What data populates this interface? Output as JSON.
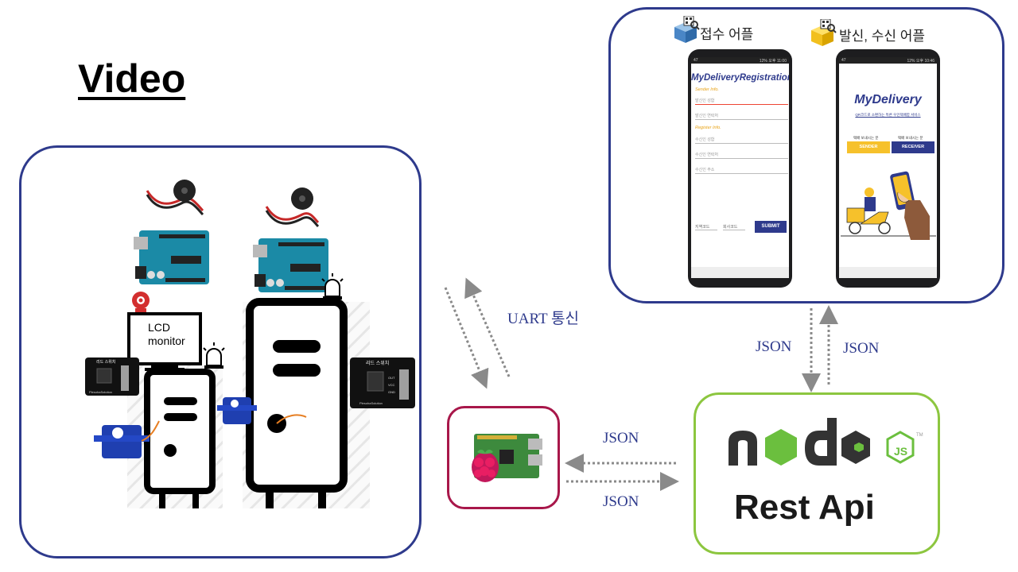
{
  "title": "Video",
  "video": {
    "lcd_label_line1": "LCD",
    "lcd_label_line2": "monitor",
    "reed_switch_label": "리드 스위치",
    "reed_pins": [
      "OUT",
      "VCC",
      "GND"
    ],
    "reed_brand": "PlesohaSolution",
    "arduino_label": "UNO"
  },
  "links": {
    "uart": "UART 통신",
    "json_app_down": "JSON",
    "json_app_up": "JSON",
    "json_pi_top": "JSON",
    "json_pi_bottom": "JSON"
  },
  "apps": {
    "reception_label": "접수 어플",
    "sendrecv_label": "발신, 수신 어플",
    "status_left": "47",
    "status_right": "12% 오후 11:00",
    "status_right2": "12% 오후 10:46",
    "registration": {
      "title": "MyDeliveryRegistration",
      "sender_section": "Sender Info.",
      "sender_fields": [
        "발신인 성함",
        "발신인 연락처"
      ],
      "register_section": "Register Info.",
      "register_fields": [
        "수신인 성함",
        "수신인 연락처",
        "수신인 주소"
      ],
      "area_code": "지역코드",
      "company_code": "회사코드",
      "submit": "SUBMIT"
    },
    "delivery": {
      "title": "MyDelivery",
      "subtitle": "QR코드로 소편하는 특른 우인택배함 서비스",
      "send_caption": "택배 보내시는 분",
      "recv_caption": "택배 보내시는 분",
      "sender_btn": "SENDER",
      "receiver_btn": "RECEIVER"
    }
  },
  "server": {
    "node_text": "node",
    "js_badge": "JS",
    "tm": "TM",
    "rest_api": "Rest Api"
  },
  "colors": {
    "frame_blue": "#2e3a8c",
    "pi_border": "#a8174a",
    "node_border": "#8cc63f",
    "node_green": "#6bbf3e",
    "node_dark": "#333333",
    "arrow_gray": "#8a8a8a"
  }
}
